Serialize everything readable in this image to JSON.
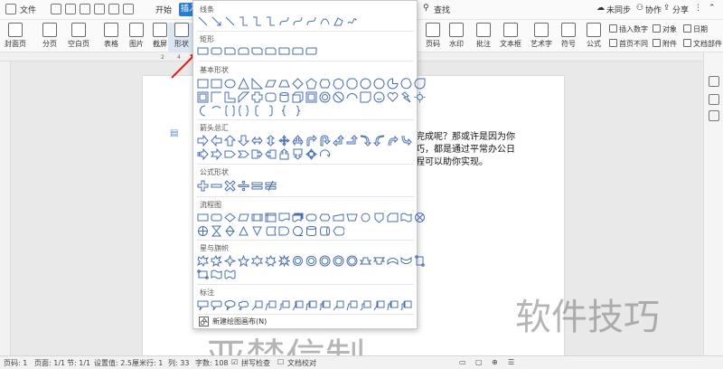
{
  "menubar": {
    "file_label": "文件",
    "start_label": "开始",
    "insert_label": "插入",
    "search_label": "查找",
    "sync_label": "未同步",
    "collab_label": "协作",
    "share_label": "分享"
  },
  "ribbon": {
    "cover": "封面页",
    "page_break": "分页",
    "blank_page": "空白页",
    "table": "表格",
    "picture": "图片",
    "screenshot": "截屏",
    "shapes": "形状",
    "page_number": "页码",
    "watermark": "水印",
    "comment": "批注",
    "textbox": "文本框",
    "wordart": "艺术字",
    "symbol": "符号",
    "formula": "公式",
    "insert_number": "插入数字",
    "object": "对象",
    "date": "日期",
    "header_footer": "首页不同",
    "attachment": "附件",
    "doc_parts": "文档部件"
  },
  "document": {
    "line1": "完成呢？那或许是因为你",
    "line2": "巧，都是通过平常办公日",
    "line3": "程可以助你实现。"
  },
  "dropdown": {
    "lines_title": "线条",
    "rect_title": "矩形",
    "basic_title": "基本形状",
    "arrows_title": "箭头总汇",
    "formula_title": "公式形状",
    "flowchart_title": "流程图",
    "stars_title": "星与旗帜",
    "callouts_title": "标注",
    "new_canvas": "新建绘图画布(N)"
  },
  "watermark": {
    "right_text": "软件技巧",
    "bottom_text": "亚禁信制"
  },
  "statusbar": {
    "page_num": "页码: 1",
    "pages": "页面: 1/1",
    "section": "节: 1/1",
    "setting": "设置值: 2.5厘米",
    "row": "行: 1",
    "col": "列: 33",
    "wordcount": "字数: 108",
    "spellcheck": "拼写检查",
    "proofread": "文档校对"
  },
  "colors": {
    "accent": "#2b7cd3",
    "shape_stroke": "#4a6fb0",
    "arrow": "#e02020"
  }
}
